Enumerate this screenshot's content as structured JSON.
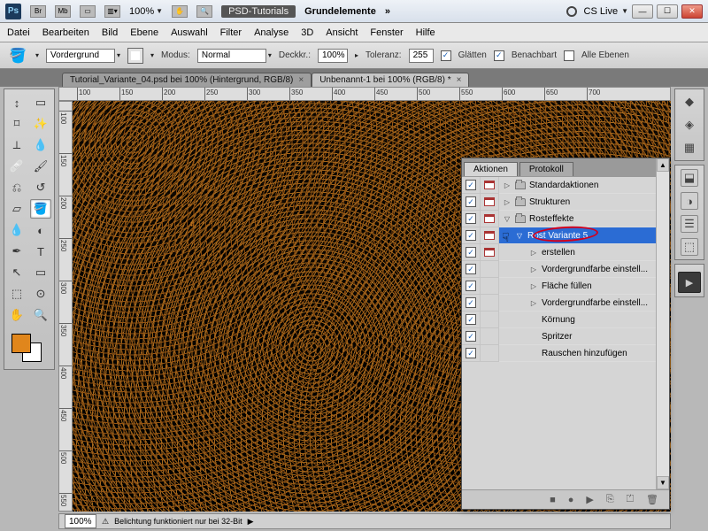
{
  "titlebar": {
    "psd_tutorials": "PSD-Tutorials",
    "workspace": "Grundelemente",
    "cs_live": "CS Live"
  },
  "menu": [
    "Datei",
    "Bearbeiten",
    "Bild",
    "Ebene",
    "Auswahl",
    "Filter",
    "Analyse",
    "3D",
    "Ansicht",
    "Fenster",
    "Hilfe"
  ],
  "options": {
    "vordergrund": "Vordergrund",
    "modus": "Modus:",
    "modus_val": "Normal",
    "deckkr": "Deckkr.:",
    "deckkr_val": "100%",
    "toleranz": "Toleranz:",
    "toleranz_val": "255",
    "glaetten": "Glätten",
    "benachbart": "Benachbart",
    "alle_ebenen": "Alle Ebenen"
  },
  "tabs": [
    {
      "label": "Tutorial_Variante_04.psd bei 100% (Hintergrund, RGB/8)",
      "active": false
    },
    {
      "label": "Unbenannt-1 bei 100% (RGB/8) *",
      "active": true
    }
  ],
  "ruler_marks": [
    100,
    150,
    200,
    250,
    300,
    350,
    400,
    450,
    500,
    550,
    600,
    650,
    700
  ],
  "ruler_v_marks": [
    100,
    150,
    200,
    250,
    300,
    350,
    400,
    450,
    500,
    550
  ],
  "status": {
    "zoom": "100%",
    "msg": "Belichtung funktioniert nur bei 32-Bit"
  },
  "zoom_title": "100%",
  "panel": {
    "tab_actions": "Aktionen",
    "tab_protocol": "Protokoll",
    "rows": [
      {
        "chk": true,
        "modal": true,
        "indent": 0,
        "disclose": "▷",
        "folder": true,
        "label": "Standardaktionen"
      },
      {
        "chk": true,
        "modal": true,
        "indent": 0,
        "disclose": "▷",
        "folder": true,
        "label": "Strukturen"
      },
      {
        "chk": true,
        "modal": true,
        "indent": 0,
        "disclose": "▽",
        "folder": true,
        "label": "Rosteffekte"
      },
      {
        "chk": true,
        "modal": true,
        "indent": 1,
        "disclose": "▽",
        "folder": false,
        "label": "Rost Variante 5",
        "sel": true
      },
      {
        "chk": true,
        "modal": "cursor",
        "indent": 2,
        "disclose": "▷",
        "folder": false,
        "label": "erstellen"
      },
      {
        "chk": true,
        "modal": false,
        "indent": 2,
        "disclose": "▷",
        "folder": false,
        "label": "Vordergrundfarbe einstell..."
      },
      {
        "chk": true,
        "modal": false,
        "indent": 2,
        "disclose": "▷",
        "folder": false,
        "label": "Fläche füllen"
      },
      {
        "chk": true,
        "modal": false,
        "indent": 2,
        "disclose": "▷",
        "folder": false,
        "label": "Vordergrundfarbe einstell..."
      },
      {
        "chk": true,
        "modal": false,
        "indent": 2,
        "disclose": "",
        "folder": false,
        "label": "Körnung"
      },
      {
        "chk": true,
        "modal": false,
        "indent": 2,
        "disclose": "",
        "folder": false,
        "label": "Spritzer"
      },
      {
        "chk": true,
        "modal": false,
        "indent": 2,
        "disclose": "",
        "folder": false,
        "label": "Rauschen hinzufügen"
      }
    ],
    "footer_icons": [
      "■",
      "●",
      "▶",
      "⎘",
      "⏍",
      "🗑"
    ]
  },
  "colors": {
    "fg": "#e0861c",
    "bg": "#ffffff",
    "selection": "#2b6cd4"
  }
}
